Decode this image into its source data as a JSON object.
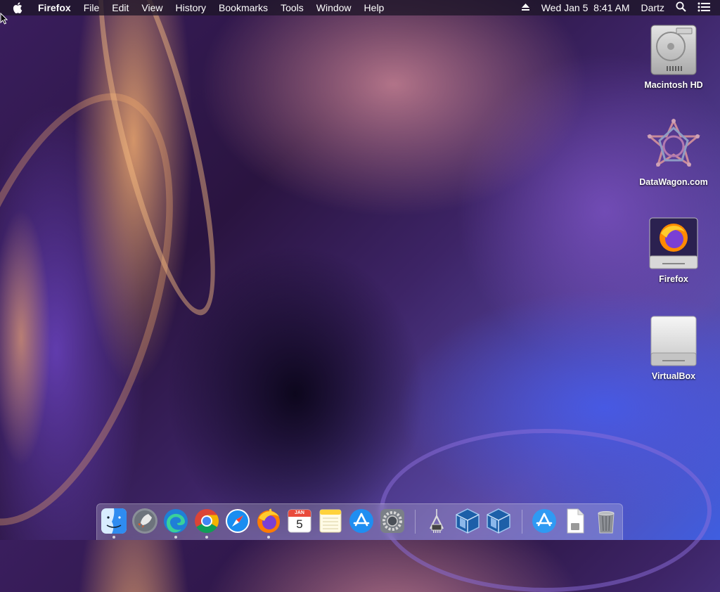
{
  "menubar": {
    "apple_icon": "apple-logo-icon",
    "app_name": "Firefox",
    "menus": [
      "File",
      "Edit",
      "View",
      "History",
      "Bookmarks",
      "Tools",
      "Window",
      "Help"
    ],
    "datetime": "Wed Jan 5  8:41 AM",
    "user": "Dartz",
    "status_icons": [
      "eject-icon",
      "spotlight-search-icon",
      "notification-center-icon"
    ]
  },
  "desktop_icons": [
    {
      "label": "Macintosh HD",
      "icon": "hard-drive-icon"
    },
    {
      "label": "DataWagon.com",
      "icon": "datawagon-logo-icon"
    },
    {
      "label": "Firefox",
      "icon": "firefox-disk-image-icon"
    },
    {
      "label": "VirtualBox",
      "icon": "external-drive-icon"
    }
  ],
  "dock": {
    "apps": [
      {
        "icon": "finder-icon",
        "running": true
      },
      {
        "icon": "launchpad-icon",
        "running": false
      },
      {
        "icon": "edge-icon",
        "running": true
      },
      {
        "icon": "chrome-icon",
        "running": true
      },
      {
        "icon": "safari-icon",
        "running": false
      },
      {
        "icon": "firefox-icon",
        "running": true
      },
      {
        "icon": "calendar-icon",
        "running": false,
        "calendar_month": "JAN",
        "calendar_day": "5"
      },
      {
        "icon": "notes-icon",
        "running": false
      },
      {
        "icon": "app-store-icon",
        "running": false
      },
      {
        "icon": "system-preferences-icon",
        "running": false
      },
      {
        "icon": "usb-cable-icon",
        "running": false
      },
      {
        "icon": "virtualbox-icon",
        "running": false
      },
      {
        "icon": "virtualbox-icon",
        "running": false
      },
      {
        "icon": "app-store-folder-icon",
        "running": false
      },
      {
        "icon": "document-icon",
        "running": false
      },
      {
        "icon": "trash-icon",
        "running": false
      }
    ]
  },
  "colors": {
    "menubar_bg": "#1e1628",
    "wallpaper_accent_orange": "#f0aa6e",
    "wallpaper_accent_blue": "#465ae6",
    "wallpaper_base": "#2a1440"
  }
}
